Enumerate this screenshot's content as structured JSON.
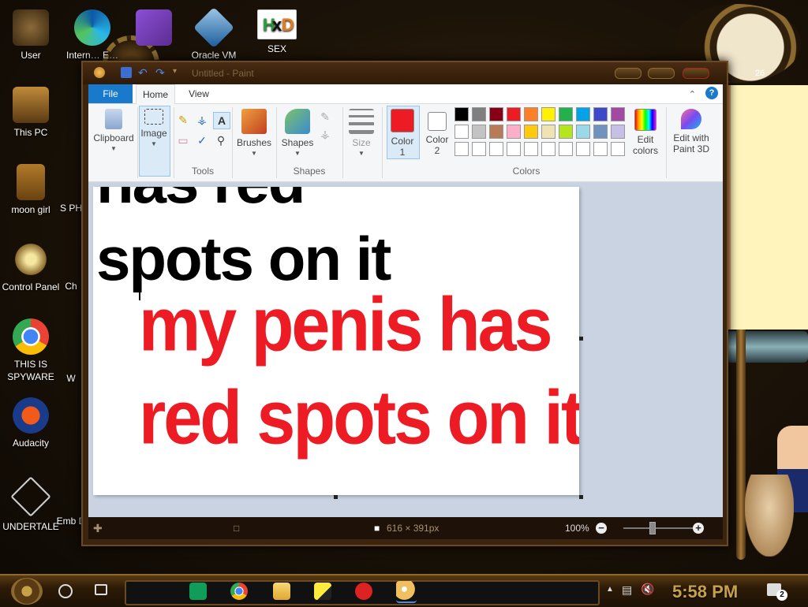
{
  "desktop": {
    "icons": [
      {
        "label": "User"
      },
      {
        "label": "Intern… E…"
      },
      {
        "label": "Oracle VM"
      },
      {
        "label": "SEX"
      },
      {
        "label": "This PC"
      },
      {
        "label": "moon girl"
      },
      {
        "label": "Control Panel"
      },
      {
        "label": "THIS IS SPYWARE"
      },
      {
        "label": "Audacity"
      },
      {
        "label": "UNDERTALE"
      },
      {
        "label": "S PH"
      },
      {
        "label": "Ch"
      },
      {
        "label": "W"
      },
      {
        "label": "Emb D"
      }
    ],
    "sticky_date": "26"
  },
  "paint": {
    "title": "Untitled - Paint",
    "tabs": {
      "file": "File",
      "home": "Home",
      "view": "View"
    },
    "ribbon": {
      "clipboard": "Clipboard",
      "image": "Image",
      "tools_group": "Tools",
      "brushes": "Brushes",
      "shapes": "Shapes",
      "shapes_group": "Shapes",
      "size": "Size",
      "color1": "Color 1",
      "color2": "Color 2",
      "edit_colors": "Edit colors",
      "edit_paint3d": "Edit with Paint 3D",
      "colors_group": "Colors"
    },
    "canvas": {
      "black_line1": "has red",
      "black_line2": "spots on it",
      "red_line1": "my penis has",
      "red_line2": "red spots on it"
    },
    "status": {
      "dimensions": "616 × 391px",
      "zoom": "100%"
    },
    "colors": {
      "color1": "#ed1c24",
      "color2": "#ffffff",
      "palette_row1": [
        "#000000",
        "#7f7f7f",
        "#880015",
        "#ed1c24",
        "#ff7f27",
        "#fff200",
        "#22b14c",
        "#00a2e8",
        "#3f48cc",
        "#a349a4"
      ],
      "palette_row2": [
        "#ffffff",
        "#c3c3c3",
        "#b97a57",
        "#ffaec9",
        "#ffc90e",
        "#efe4b0",
        "#b5e61d",
        "#99d9ea",
        "#7092be",
        "#c8bfe7"
      ],
      "palette_row3": [
        "#ffffff",
        "#ffffff",
        "#ffffff",
        "#ffffff",
        "#ffffff",
        "#ffffff",
        "#ffffff",
        "#ffffff",
        "#ffffff",
        "#ffffff"
      ]
    }
  },
  "taskbar": {
    "time": "5:58 PM",
    "notifications": "2"
  }
}
